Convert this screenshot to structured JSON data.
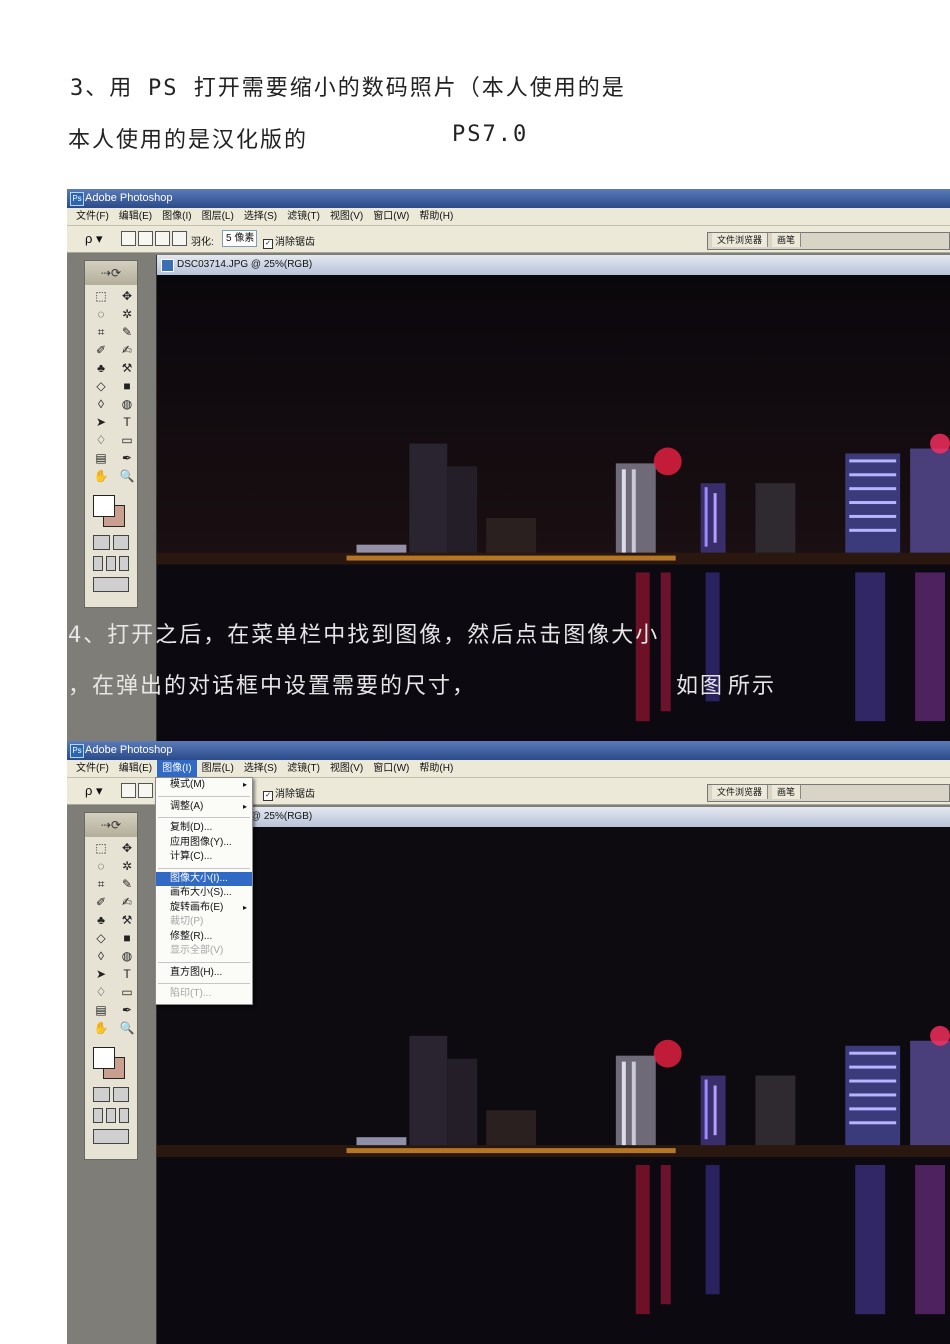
{
  "doc": {
    "line1_a": "3、用",
    "line1_b": "PS 打开需要缩小的数码照片（本人使用的是",
    "line2_a": "本人使用的是汉化版的",
    "line2_b": "PS7.0",
    "line3": "4、打开之后，在菜单栏中找到图像，然后点击图像大小",
    "line4_a": "，在弹出的对话框中设置需要的尺寸，",
    "line4_b": "如图",
    "line4_c": "所示"
  },
  "app": {
    "title": "Adobe Photoshop",
    "logo_glyph": "Ps",
    "menu": [
      "文件(F)",
      "编辑(E)",
      "图像(I)",
      "图层(L)",
      "选择(S)",
      "滤镜(T)",
      "视图(V)",
      "窗口(W)",
      "帮助(H)"
    ],
    "options": {
      "tool_glyph": "ρ ▾",
      "feather_label": "羽化:",
      "feather_value": "5 像素",
      "check_glyph": "✓",
      "antialias_label": "消除锯齿"
    },
    "palette_tabs": [
      "文件浏览器",
      "画笔"
    ],
    "toolbox": {
      "header_glyph": "⇢⟳",
      "tools": [
        "⬚",
        "✥",
        "◌",
        "✲",
        "⌗",
        "✎",
        "✐",
        "✍",
        "♣",
        "⚒",
        "◇",
        "■",
        "◊",
        "◍",
        "➤",
        "T",
        "♢",
        "▭",
        "▤",
        "✒",
        "✋",
        "🔍"
      ]
    },
    "doc_title": "DSC03714.JPG @ 25%(RGB)",
    "image_menu": [
      {
        "label": "模式(M)",
        "submenu": true
      },
      {
        "label": "调整(A)",
        "submenu": true,
        "sep_before": true
      },
      {
        "label": "复制(D)...",
        "sep_before": true
      },
      {
        "label": "应用图像(Y)..."
      },
      {
        "label": "计算(C)..."
      },
      {
        "label": "图像大小(I)...",
        "sep_before": true,
        "highlight": true
      },
      {
        "label": "画布大小(S)..."
      },
      {
        "label": "旋转画布(E)",
        "submenu": true
      },
      {
        "label": "裁切(P)",
        "disabled": true
      },
      {
        "label": "修整(R)..."
      },
      {
        "label": "显示全部(V)",
        "disabled": true
      },
      {
        "label": "直方图(H)...",
        "sep_before": true
      },
      {
        "label": "陷印(T)...",
        "sep_before": true,
        "disabled": true
      }
    ],
    "submenu_glyph": "▸"
  }
}
